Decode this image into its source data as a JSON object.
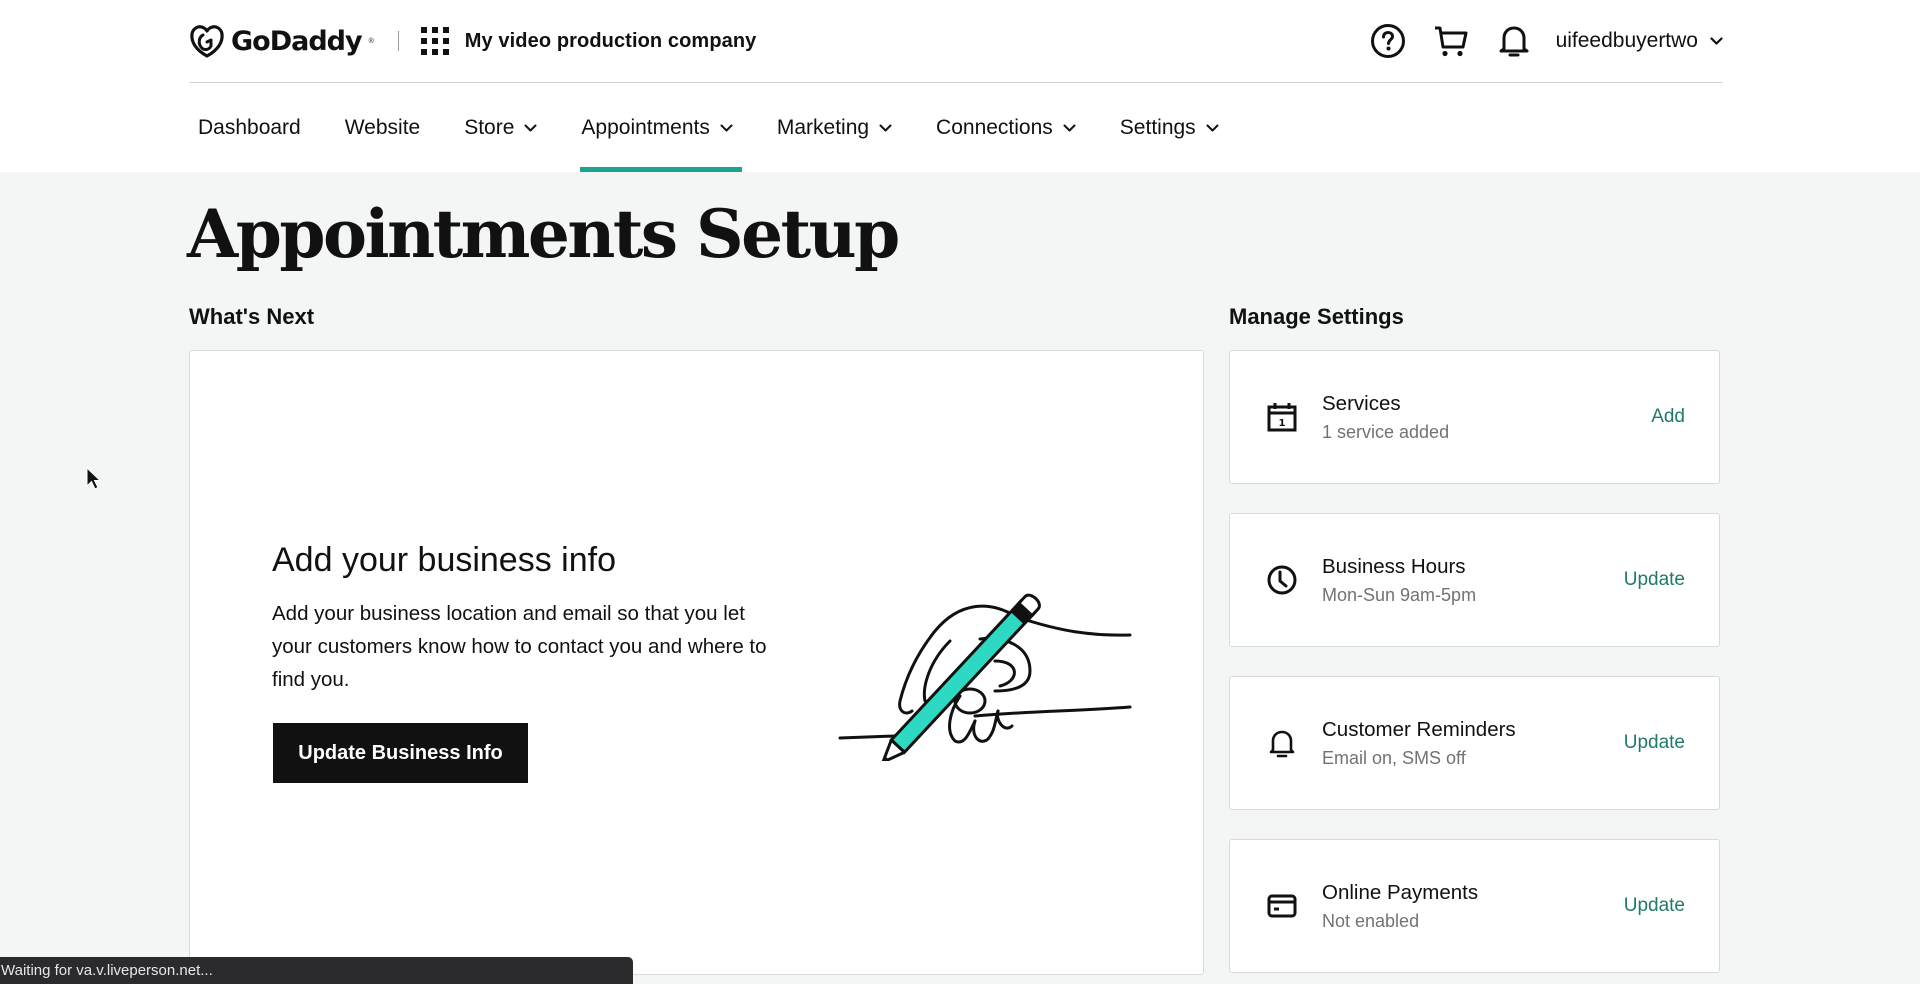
{
  "header": {
    "brand": "GoDaddy",
    "company_name": "My video production company",
    "username": "uifeedbuyertwo",
    "icons": [
      "help-icon",
      "cart-icon",
      "bell-icon"
    ]
  },
  "nav": {
    "items": [
      {
        "label": "Dashboard",
        "has_dropdown": false,
        "active": false
      },
      {
        "label": "Website",
        "has_dropdown": false,
        "active": false
      },
      {
        "label": "Store",
        "has_dropdown": true,
        "active": false
      },
      {
        "label": "Appointments",
        "has_dropdown": true,
        "active": true
      },
      {
        "label": "Marketing",
        "has_dropdown": true,
        "active": false
      },
      {
        "label": "Connections",
        "has_dropdown": true,
        "active": false
      },
      {
        "label": "Settings",
        "has_dropdown": true,
        "active": false
      }
    ]
  },
  "page": {
    "title": "Appointments Setup",
    "whats_next_label": "What's Next",
    "manage_settings_label": "Manage Settings"
  },
  "whats_next": {
    "title": "Add your business info",
    "description": "Add your business location and email so that you let your customers know how to contact you and where to find you.",
    "button_label": "Update Business Info"
  },
  "settings": [
    {
      "icon": "calendar-icon",
      "title": "Services",
      "subtitle": "1 service added",
      "action": "Add"
    },
    {
      "icon": "clock-icon",
      "title": "Business Hours",
      "subtitle": "Mon-Sun 9am-5pm",
      "action": "Update"
    },
    {
      "icon": "bell-icon",
      "title": "Customer Reminders",
      "subtitle": "Email on, SMS off",
      "action": "Update"
    },
    {
      "icon": "credit-card-icon",
      "title": "Online Payments",
      "subtitle": "Not enabled",
      "action": "Update"
    }
  ],
  "status_bar": {
    "text": "Waiting for va.v.liveperson.net..."
  },
  "colors": {
    "accent": "#1ba590",
    "link": "#1f7a6a",
    "background": "#f3f6f5",
    "button": "#111111"
  }
}
